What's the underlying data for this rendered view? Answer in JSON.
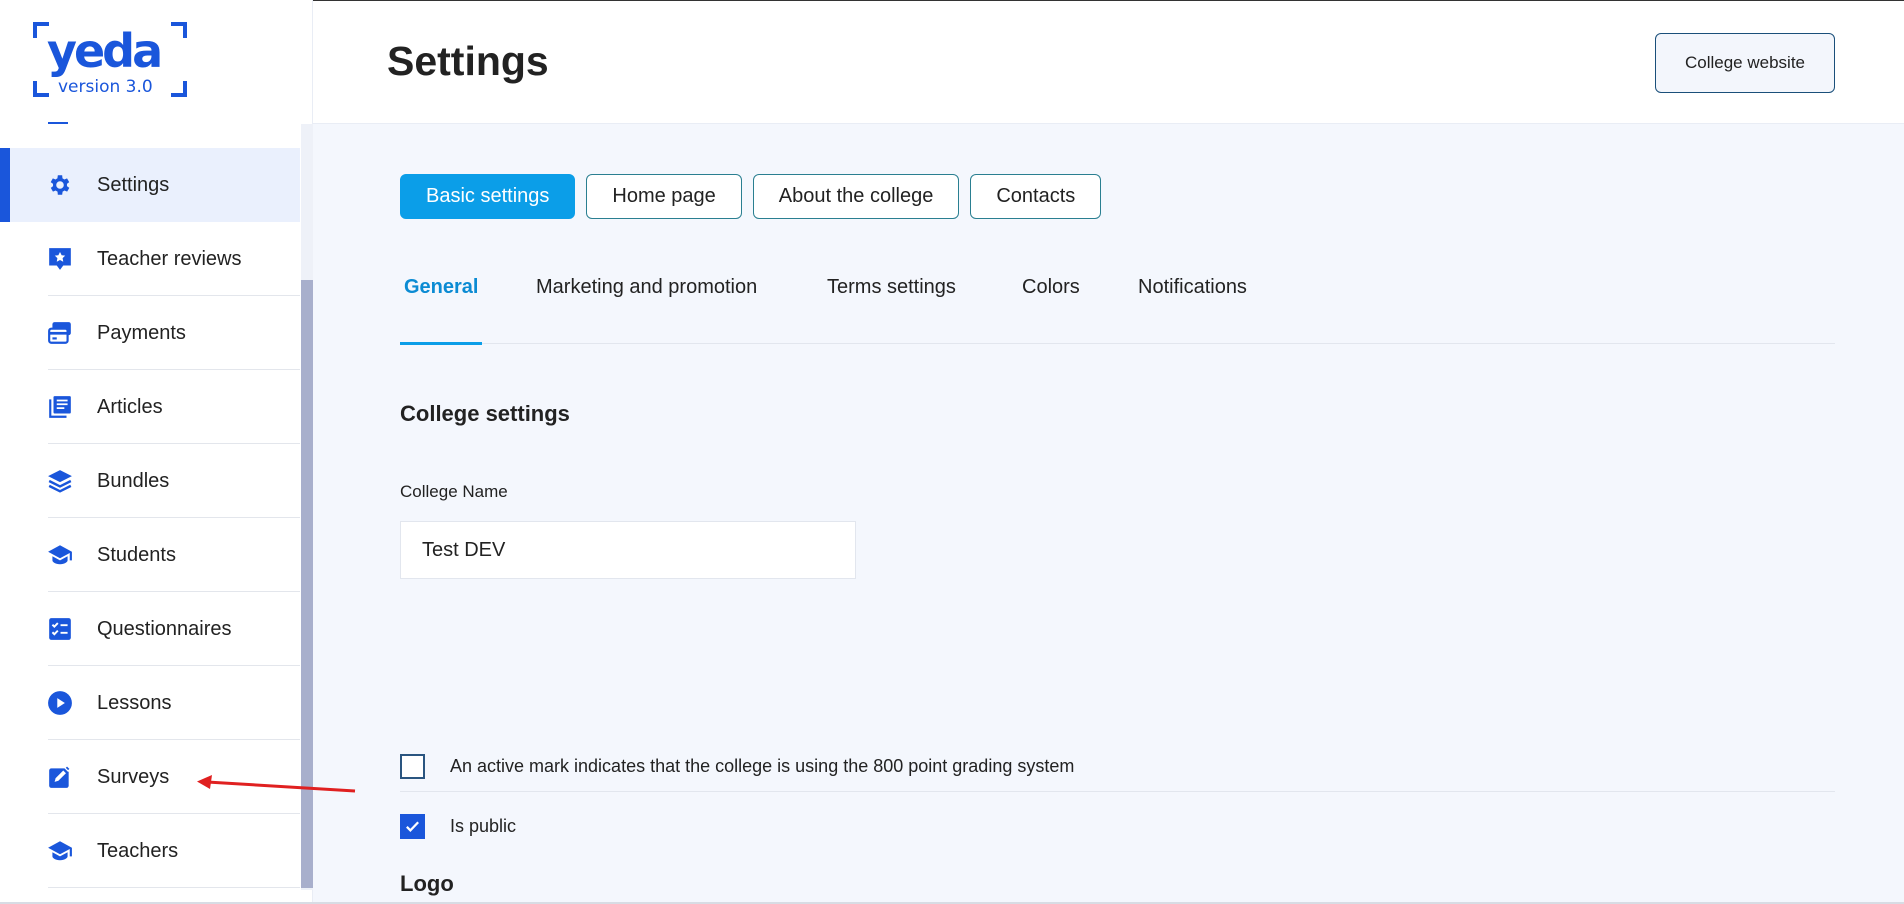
{
  "app": {
    "logo_word": "yeda",
    "logo_version": "version 3.0"
  },
  "sidebar": {
    "items": [
      {
        "label": "Settings",
        "icon": "gear-icon",
        "active": true
      },
      {
        "label": "Teacher reviews",
        "icon": "star-comment-icon"
      },
      {
        "label": "Payments",
        "icon": "credit-cards-icon"
      },
      {
        "label": "Articles",
        "icon": "articles-icon"
      },
      {
        "label": "Bundles",
        "icon": "layers-icon"
      },
      {
        "label": "Students",
        "icon": "graduation-cap-icon"
      },
      {
        "label": "Questionnaires",
        "icon": "checklist-icon"
      },
      {
        "label": "Lessons",
        "icon": "play-circle-icon"
      },
      {
        "label": "Surveys",
        "icon": "edit-square-icon"
      },
      {
        "label": "Teachers",
        "icon": "graduation-cap-icon"
      }
    ]
  },
  "header": {
    "title": "Settings",
    "site_button": "College website"
  },
  "pills": [
    {
      "label": "Basic settings",
      "active": true
    },
    {
      "label": "Home page"
    },
    {
      "label": "About the college"
    },
    {
      "label": "Contacts"
    }
  ],
  "tabs": [
    {
      "label": "General",
      "active": true
    },
    {
      "label": "Marketing and promotion"
    },
    {
      "label": "Terms settings"
    },
    {
      "label": "Colors"
    },
    {
      "label": "Notifications"
    }
  ],
  "college_settings": {
    "section_title": "College settings",
    "name_label": "College Name",
    "name_value": "Test DEV",
    "checkboxes": [
      {
        "label": "An active mark indicates that the college is using the 800 point grading system",
        "checked": false
      },
      {
        "label": "Is public",
        "checked": true
      }
    ]
  },
  "logo_section": {
    "title": "Logo"
  },
  "colors": {
    "brand": "#1a56db",
    "pill_active": "#0b9ee8",
    "annotation": "#e02020"
  }
}
